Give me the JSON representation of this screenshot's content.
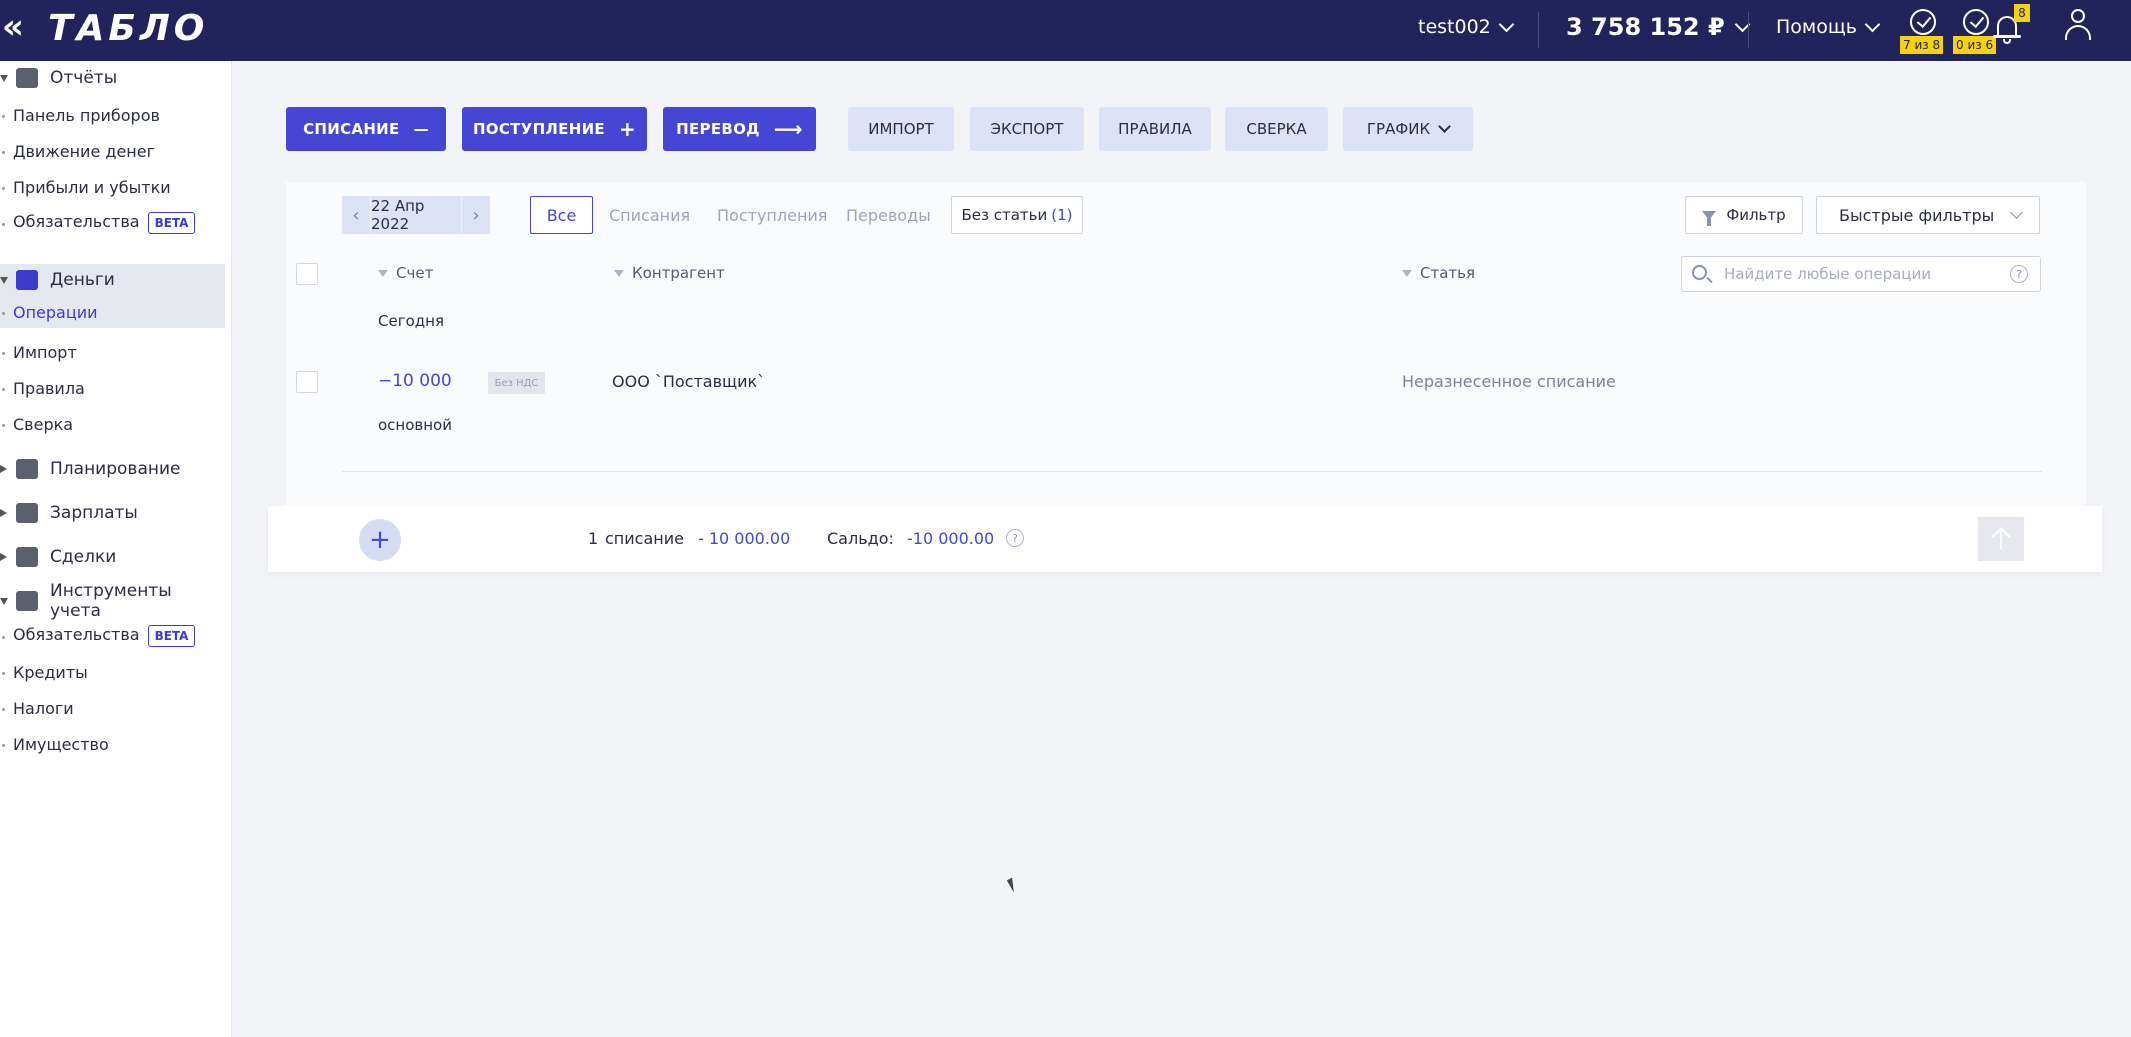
{
  "topbar": {
    "collapse_icon": "«",
    "logo": "ТАБЛО",
    "user": "test002",
    "balance": "3 758 152 ₽",
    "help": "Помощь",
    "tasks1": "7 из 8",
    "tasks2": "0 из 6",
    "notifications": "8",
    "colors": {
      "bar": "#23235c",
      "badge": "#f5d10e"
    }
  },
  "sidebar": {
    "reports": {
      "label": "Отчёты",
      "items": [
        "Панель приборов",
        "Движение денег",
        "Прибыли и убытки",
        "Обязательства"
      ],
      "beta": "BETA"
    },
    "money": {
      "label": "Деньги",
      "items": [
        "Операции",
        "Импорт",
        "Правила",
        "Сверка"
      ],
      "active": "Операции"
    },
    "planning": "Планирование",
    "salary": "Зарплаты",
    "deals": "Сделки",
    "tools": {
      "label": "Инструменты учета",
      "items": [
        "Обязательства",
        "Кредиты",
        "Налоги",
        "Имущество"
      ],
      "beta": "BETA"
    }
  },
  "toolbar": {
    "writeoff": "СПИСАНИЕ",
    "writeoff_icon": "—",
    "income": "ПОСТУПЛЕНИЕ",
    "income_icon": "+",
    "transfer": "ПЕРЕВОД",
    "transfer_icon": "⟶",
    "import": "ИМПОРТ",
    "export": "ЭКСПОРТ",
    "rules": "ПРАВИЛА",
    "reconcile": "СВЕРКА",
    "schedule": "ГРАФИК",
    "accent": "#4646d4"
  },
  "filters": {
    "prev": "‹",
    "date": "22 Апр 2022",
    "next": "›",
    "all": "Все",
    "writeoffs": "Списания",
    "incomes": "Поступления",
    "transfers": "Переводы",
    "no_category": "Без статьи",
    "no_category_count": "(1)",
    "filter": "Фильтр",
    "quick_filters": "Быстрые фильтры"
  },
  "table": {
    "col_account": "Счет",
    "col_counterparty": "Контрагент",
    "col_category": "Статья",
    "search_placeholder": "Найдите любые операции",
    "help": "?",
    "group_today": "Сегодня",
    "rows": [
      {
        "amount": "−10 000",
        "vat": "Без НДС",
        "counterparty": "ООО `Поставщик`",
        "category": "Неразнесенное списание",
        "account": "основной"
      }
    ]
  },
  "footer": {
    "add": "+",
    "count": "1",
    "count_label": "списание",
    "sum": "- 10 000.00",
    "saldo_label": "Сальдо:",
    "saldo": "-10 000.00",
    "help": "?"
  }
}
